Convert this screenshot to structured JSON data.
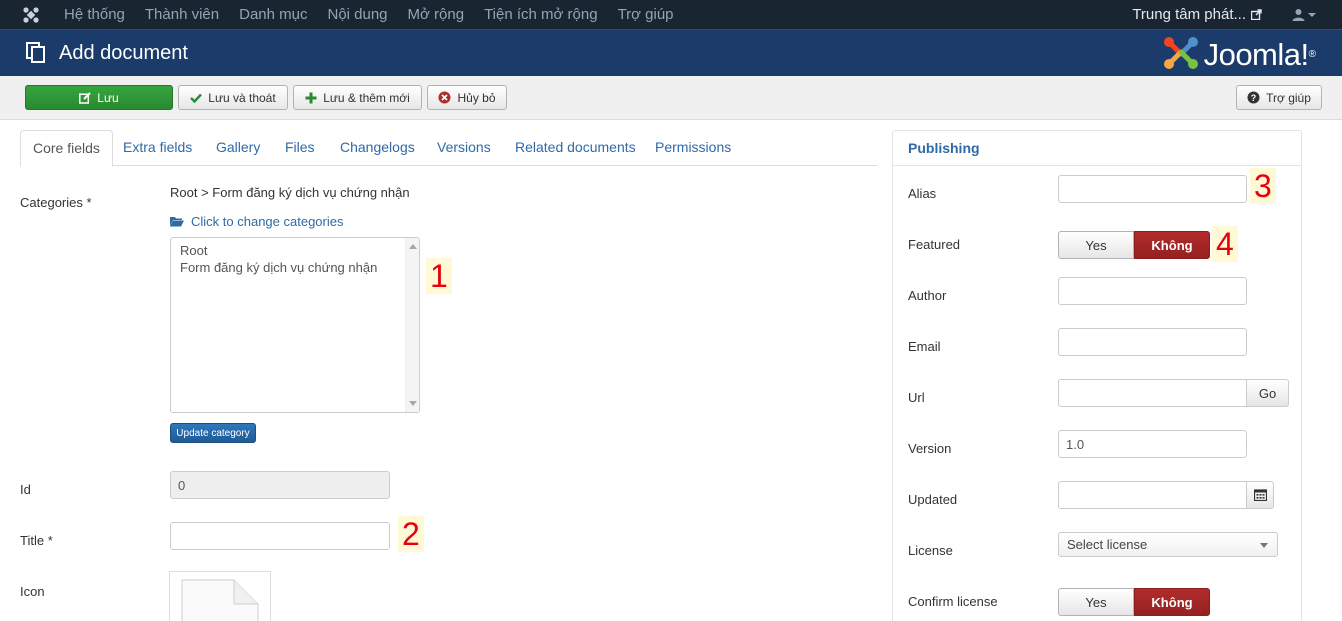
{
  "topnav": {
    "menu": [
      "Hệ thống",
      "Thành viên",
      "Danh mục",
      "Nội dung",
      "Mở rộng",
      "Tiện ích mở rộng",
      "Trợ giúp"
    ],
    "site_name": "Trung tâm phát..."
  },
  "header": {
    "title": "Add document",
    "brand": "Joomla!"
  },
  "toolbar": {
    "save": "Lưu",
    "save_close": "Lưu và thoát",
    "save_new": "Lưu & thêm mới",
    "cancel": "Hủy bỏ",
    "help": "Trợ giúp"
  },
  "tabs": [
    "Core fields",
    "Extra fields",
    "Gallery",
    "Files",
    "Changelogs",
    "Versions",
    "Related documents",
    "Permissions"
  ],
  "form": {
    "categories_label": "Categories *",
    "categories_path": "Root > Form đăng ký dịch vụ chứng nhận",
    "change_categories_link": "Click to change categories",
    "category_options": [
      "Root",
      "Form đăng ký dịch vụ chứng nhận"
    ],
    "update_category_button": "Update category",
    "id_label": "Id",
    "id_value": "0",
    "title_label": "Title *",
    "title_value": "",
    "icon_label": "Icon"
  },
  "annotations": [
    "1",
    "2",
    "3",
    "4"
  ],
  "publishing": {
    "heading": "Publishing",
    "alias_label": "Alias",
    "alias_value": "",
    "featured_label": "Featured",
    "yes": "Yes",
    "no": "Không",
    "featured_selected": "Không",
    "author_label": "Author",
    "author_value": "",
    "email_label": "Email",
    "email_value": "",
    "url_label": "Url",
    "url_value": "",
    "go_button": "Go",
    "version_label": "Version",
    "version_value": "1.0",
    "updated_label": "Updated",
    "updated_value": "",
    "license_label": "License",
    "license_value": "Select license",
    "confirm_license_label": "Confirm license",
    "confirm_license_selected": "Không"
  },
  "colors": {
    "topnav_bg": "#1a2532",
    "header_bg": "#1b3b6b",
    "save_green": "#2f9a37",
    "toggle_no_red": "#a22727",
    "link_blue": "#2f6aa7"
  },
  "icons": {
    "joomla_mini": "joomla-logo-icon",
    "external": "external-link-icon",
    "user": "user-icon",
    "document": "copy-documents-icon",
    "edit": "edit-icon",
    "check": "check-icon",
    "plus": "plus-icon",
    "cancel": "cancel-circle-icon",
    "help": "question-circle-icon",
    "folder": "folder-open-icon",
    "calendar": "calendar-icon"
  }
}
